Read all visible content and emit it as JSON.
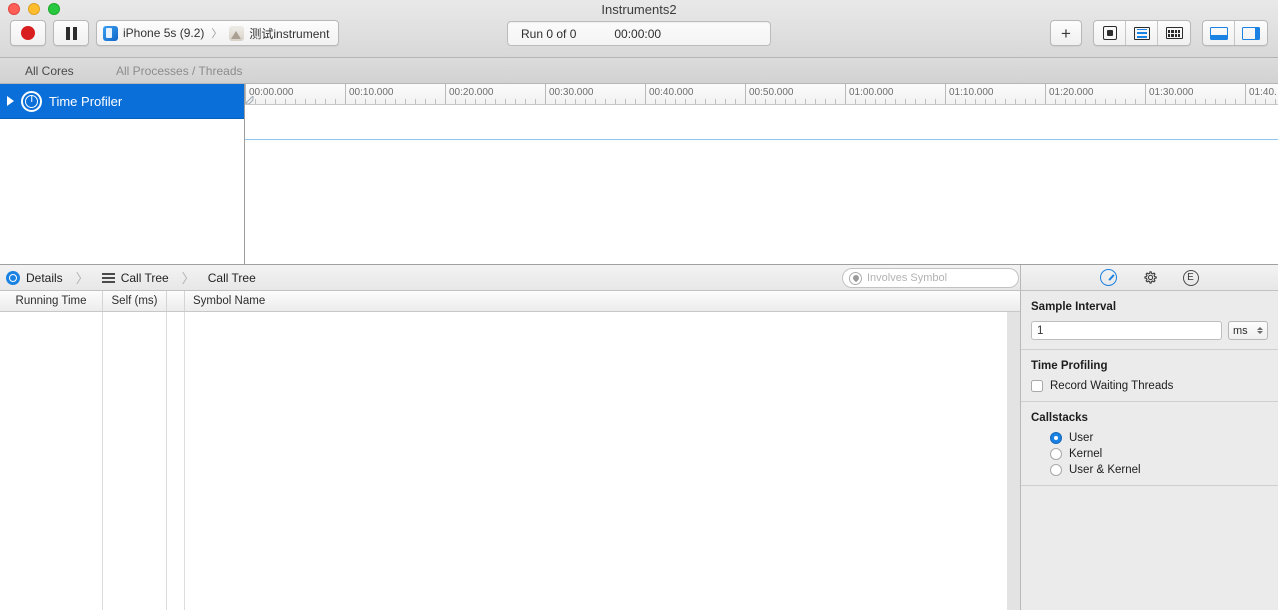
{
  "window": {
    "title": "Instruments2"
  },
  "toolbar": {
    "record_label": "Record",
    "pause_label": "Pause",
    "device_name": "iPhone 5s (9.2)",
    "target_name": "测试instrument",
    "breadcrumb_separator": "〉",
    "run_label": "Run 0 of 0",
    "run_time": "00:00:00",
    "add_label": "+",
    "icons": {
      "add": "plus-icon",
      "cpu": "chip-icon",
      "strategy": "list-lines-icon",
      "grid": "keyboard-grid-icon",
      "bottom_panel": "bottom-panel-icon",
      "right_panel": "right-panel-icon"
    }
  },
  "strategy_bar": {
    "cpu_strategy": "All Cores",
    "process_strategy": "All Processes / Threads"
  },
  "timeline": {
    "ruler_labels": [
      "00:00.000",
      "00:10.000",
      "00:20.000",
      "00:30.000",
      "00:40.000",
      "00:50.000",
      "01:00.000",
      "01:10.000",
      "01:20.000",
      "01:30.000",
      "01:40."
    ],
    "tick_spacing_px": 100,
    "minor_ticks_per_major": 10,
    "selected_accent": "#0a6fd8"
  },
  "tracks": [
    {
      "label": "Time Profiler",
      "icon": "time-profiler-icon",
      "selected": true,
      "expanded": false
    }
  ],
  "detail_bar": {
    "breadcrumbs": [
      {
        "label": "Details",
        "icon": "details-target-icon"
      },
      {
        "label": "Call Tree",
        "icon": "call-tree-icon"
      },
      {
        "label": "Call Tree",
        "icon": ""
      }
    ],
    "separator": "〉",
    "search_placeholder": "Involves Symbol",
    "search_value": ""
  },
  "inspector_tabs": [
    {
      "name": "record-settings-tab",
      "icon": "gauge-icon",
      "selected": true
    },
    {
      "name": "display-settings-tab",
      "icon": "gear-icon",
      "selected": false
    },
    {
      "name": "extended-detail-tab",
      "icon": "extended-detail-icon",
      "label": "E",
      "selected": false
    }
  ],
  "table": {
    "columns": [
      "Running Time",
      "Self (ms)",
      "Symbol Name"
    ],
    "rows": []
  },
  "inspector": {
    "sample_interval": {
      "title": "Sample Interval",
      "value": "1",
      "unit": "ms"
    },
    "time_profiling": {
      "title": "Time Profiling",
      "record_waiting_threads_label": "Record Waiting Threads",
      "record_waiting_threads_checked": false
    },
    "callstacks": {
      "title": "Callstacks",
      "options": [
        {
          "label": "User",
          "selected": true
        },
        {
          "label": "Kernel",
          "selected": false
        },
        {
          "label": "User & Kernel",
          "selected": false
        }
      ]
    }
  },
  "colors": {
    "accent": "#0a6fd8",
    "record_red": "#d81e1e",
    "blue_icon": "#1a82e2"
  }
}
